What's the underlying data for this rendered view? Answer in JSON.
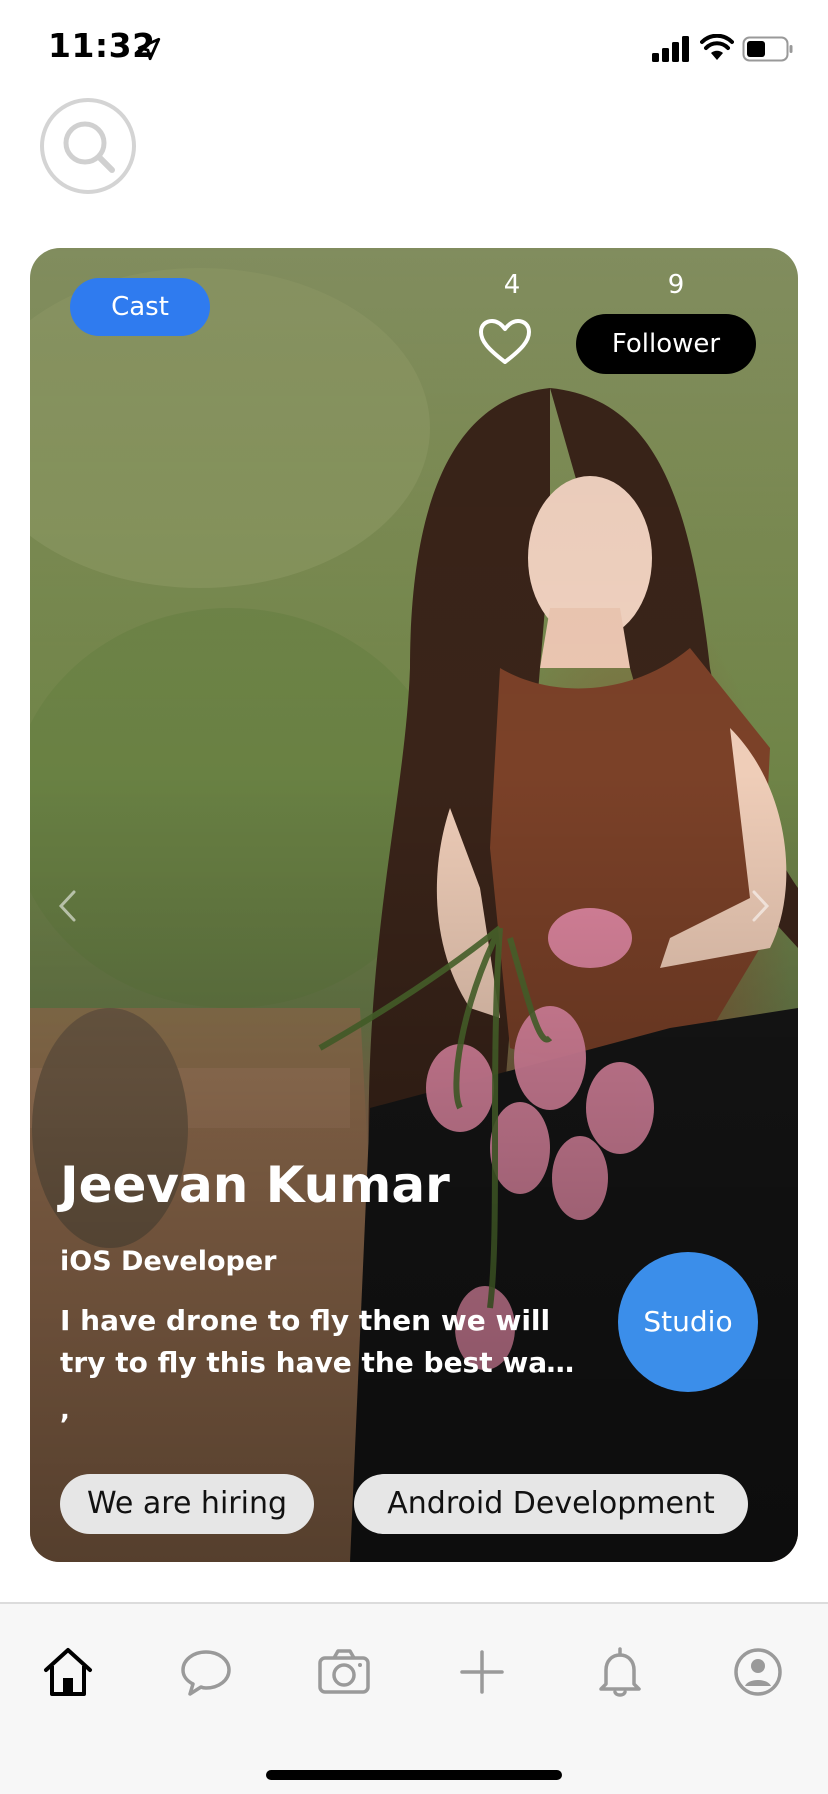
{
  "status_bar": {
    "time": "11:32"
  },
  "card": {
    "category": "Cast",
    "likes": "4",
    "followers": "9",
    "follower_label": "Follower",
    "name": "Jeevan Kumar",
    "role": "iOS Developer",
    "bio": "I have drone to fly then we will try to fly this have the best way chec...",
    "extra": ",",
    "studio_label": "Studio",
    "tags": [
      "We are hiring",
      "Android Development"
    ]
  },
  "tab_bar": {
    "items": [
      "home-icon",
      "chat-icon",
      "camera-icon",
      "add-icon",
      "bell-icon",
      "profile-icon"
    ],
    "active": "home-icon"
  },
  "colors": {
    "accent_blue": "#2f7bef",
    "studio_blue": "#3b8eea",
    "follower_black": "#000000",
    "tab_inactive": "#9a9a9a"
  }
}
